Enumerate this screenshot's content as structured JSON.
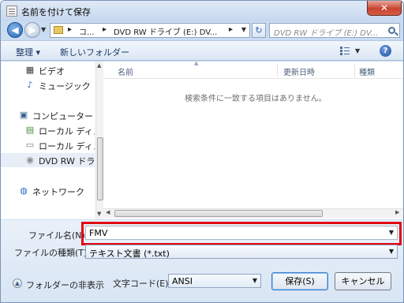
{
  "window": {
    "title": "名前を付けて保存",
    "close_label": "✕"
  },
  "address": {
    "segments": [
      "▸",
      "コ...",
      "▸",
      "DVD RW ドライブ (E:) DV...",
      "▸"
    ],
    "search_placeholder": "DVD RW ドライブ (E:) DV..."
  },
  "toolbar": {
    "organize_label": "整理 ▾",
    "new_folder_label": "新しいフォルダー",
    "help_label": "?"
  },
  "sidebar": {
    "items": [
      {
        "label": "ビデオ",
        "icon": "video-icon"
      },
      {
        "label": "ミュージック",
        "icon": "music-icon"
      },
      {
        "label": "コンピューター",
        "icon": "computer-icon"
      },
      {
        "label": "ローカル ディス",
        "icon": "disk-icon"
      },
      {
        "label": "ローカル ディス",
        "icon": "disk-icon"
      },
      {
        "label": "DVD RW ドライ",
        "icon": "dvd-icon"
      },
      {
        "label": "ネットワーク",
        "icon": "network-icon"
      }
    ]
  },
  "files": {
    "columns": [
      "名前",
      "更新日時",
      "種類"
    ],
    "empty_message": "検索条件に一致する項目はありません。"
  },
  "form": {
    "filename_label": "ファイル名(N):",
    "filename_value": "FMV",
    "filetype_label": "ファイルの種類(T):",
    "filetype_value": "テキスト文書 (*.txt)",
    "encoding_label": "文字コード(E):",
    "encoding_value": "ANSI",
    "hide_folders_label": "フォルダーの非表示",
    "save_label": "保存(S)",
    "cancel_label": "キャンセル"
  },
  "colors": {
    "highlight": "#e30613",
    "accent": "#2a66b8"
  }
}
